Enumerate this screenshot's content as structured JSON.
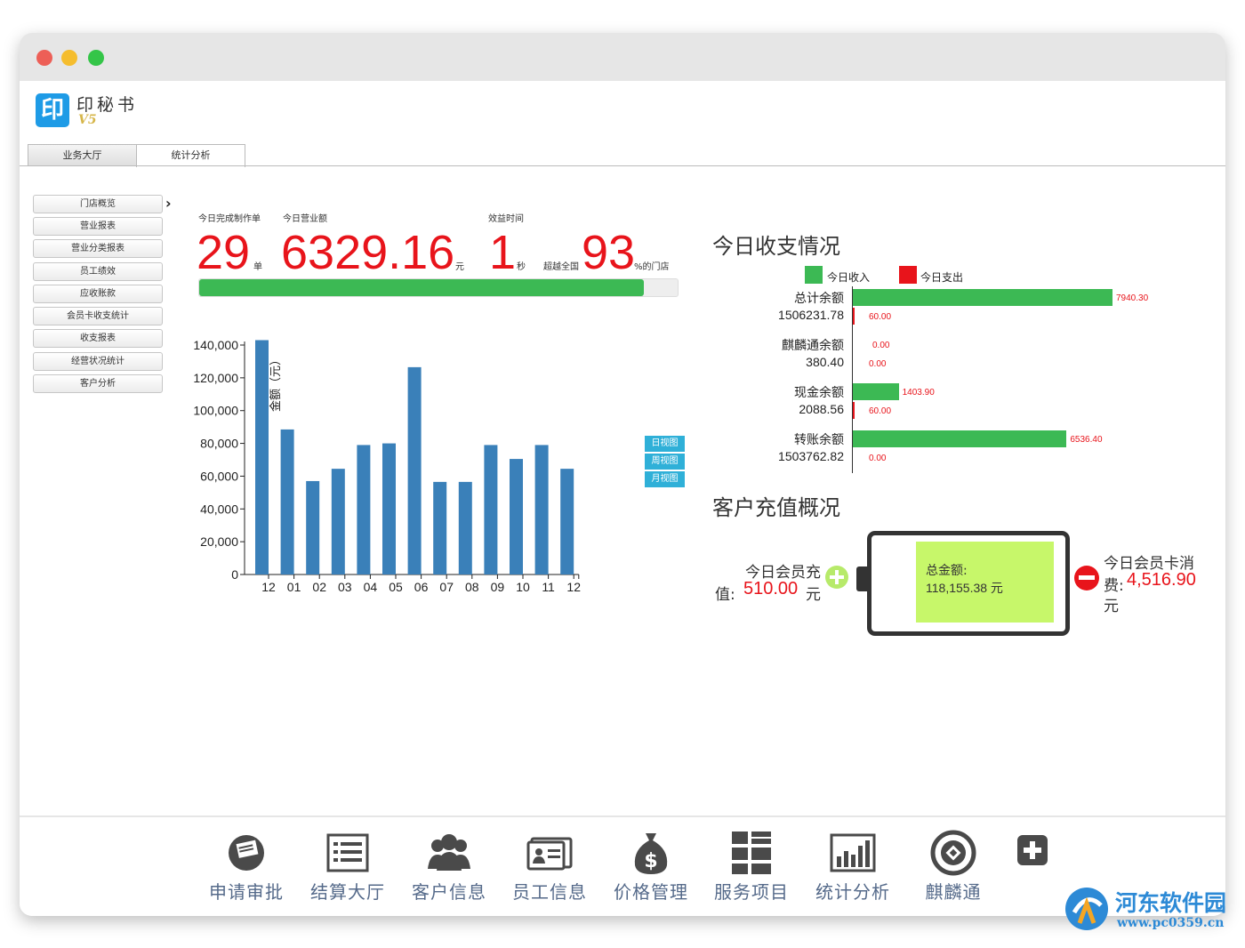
{
  "window": {
    "traffic_lights": {
      "close": "#ed5f57",
      "minimize": "#f5bd2e",
      "maximize": "#34c548"
    }
  },
  "brand": {
    "logo_char": "印",
    "name": "印秘书",
    "version": "V5"
  },
  "tabs": [
    {
      "label": "业务大厅",
      "active": false
    },
    {
      "label": "统计分析",
      "active": true
    }
  ],
  "sidebar": {
    "items": [
      {
        "label": "门店概览",
        "selected": true
      },
      {
        "label": "营业报表"
      },
      {
        "label": "营业分类报表"
      },
      {
        "label": "员工绩效"
      },
      {
        "label": "应收账款"
      },
      {
        "label": "会员卡收支统计"
      },
      {
        "label": "收支报表"
      },
      {
        "label": "经营状况统计"
      },
      {
        "label": "客户分析"
      }
    ],
    "selected_arrow": "›"
  },
  "kpi": {
    "orders_label": "今日完成制作单",
    "orders_value": "29",
    "orders_unit": "单",
    "revenue_label": "今日营业额",
    "revenue_value": "6329.16",
    "revenue_unit": "元",
    "time_label": "效益时间",
    "time_value": "1",
    "time_unit": "秒",
    "beat_prefix": "超越全国",
    "beat_value": "93",
    "beat_suffix": "%的门店",
    "progress_percent": 93
  },
  "view_buttons": [
    "日视图",
    "周视图",
    "月视图"
  ],
  "chart_data": {
    "type": "bar",
    "ylabel": "金额（元）",
    "categories": [
      "12",
      "01",
      "02",
      "03",
      "04",
      "05",
      "06",
      "07",
      "08",
      "09",
      "10",
      "11",
      "12"
    ],
    "values": [
      143000,
      88500,
      57000,
      64500,
      79000,
      80000,
      126500,
      56500,
      56500,
      79000,
      70500,
      79000,
      64500
    ],
    "yticks": [
      "140,000",
      "120,000",
      "100,000",
      "80,000",
      "60,000",
      "40,000",
      "20,000",
      "0"
    ],
    "ylim": [
      0,
      140000
    ],
    "color": "#3a80b9"
  },
  "income": {
    "title": "今日收支情况",
    "legend_income": "今日收入",
    "legend_expense": "今日支出",
    "income_color": "#3cb954",
    "expense_color": "#e8141b",
    "rows": [
      {
        "name": "总计余额",
        "balance": "1506231.78",
        "income": "7940.30",
        "expense": "60.00",
        "income_value": 7940.3,
        "expense_value": 60.0
      },
      {
        "name": "麒麟通余额",
        "balance": "380.40",
        "income": "0.00",
        "expense": "0.00",
        "income_value": 0,
        "expense_value": 0
      },
      {
        "name": "现金余额",
        "balance": "2088.56",
        "income": "1403.90",
        "expense": "60.00",
        "income_value": 1403.9,
        "expense_value": 60.0
      },
      {
        "name": "转账余额",
        "balance": "1503762.82",
        "income": "6536.40",
        "expense": "0.00",
        "income_value": 6536.4,
        "expense_value": 0
      }
    ]
  },
  "recharge": {
    "title": "客户充值概况",
    "recharge_label_a": "今日会员充",
    "recharge_label_b": "值:",
    "recharge_value": "510.00",
    "recharge_unit": "元",
    "total_label": "总金额:",
    "total_value": "118,155.38 元",
    "consume_label_a": "今日会员卡消",
    "consume_label_b": "费:",
    "consume_value": "4,516.90",
    "consume_unit": "元"
  },
  "bottom_nav": [
    {
      "label": "申请审批",
      "icon": "approval-icon"
    },
    {
      "label": "结算大厅",
      "icon": "checkout-icon"
    },
    {
      "label": "客户信息",
      "icon": "customers-icon"
    },
    {
      "label": "员工信息",
      "icon": "employee-card-icon"
    },
    {
      "label": "价格管理",
      "icon": "money-bag-icon"
    },
    {
      "label": "服务项目",
      "icon": "services-grid-icon"
    },
    {
      "label": "统计分析",
      "icon": "bar-chart-icon"
    },
    {
      "label": "麒麟通",
      "icon": "qilintong-icon"
    },
    {
      "label": "",
      "icon": "add-icon"
    }
  ],
  "watermark": {
    "name": "河东软件园",
    "url": "www.pc0359.cn"
  }
}
